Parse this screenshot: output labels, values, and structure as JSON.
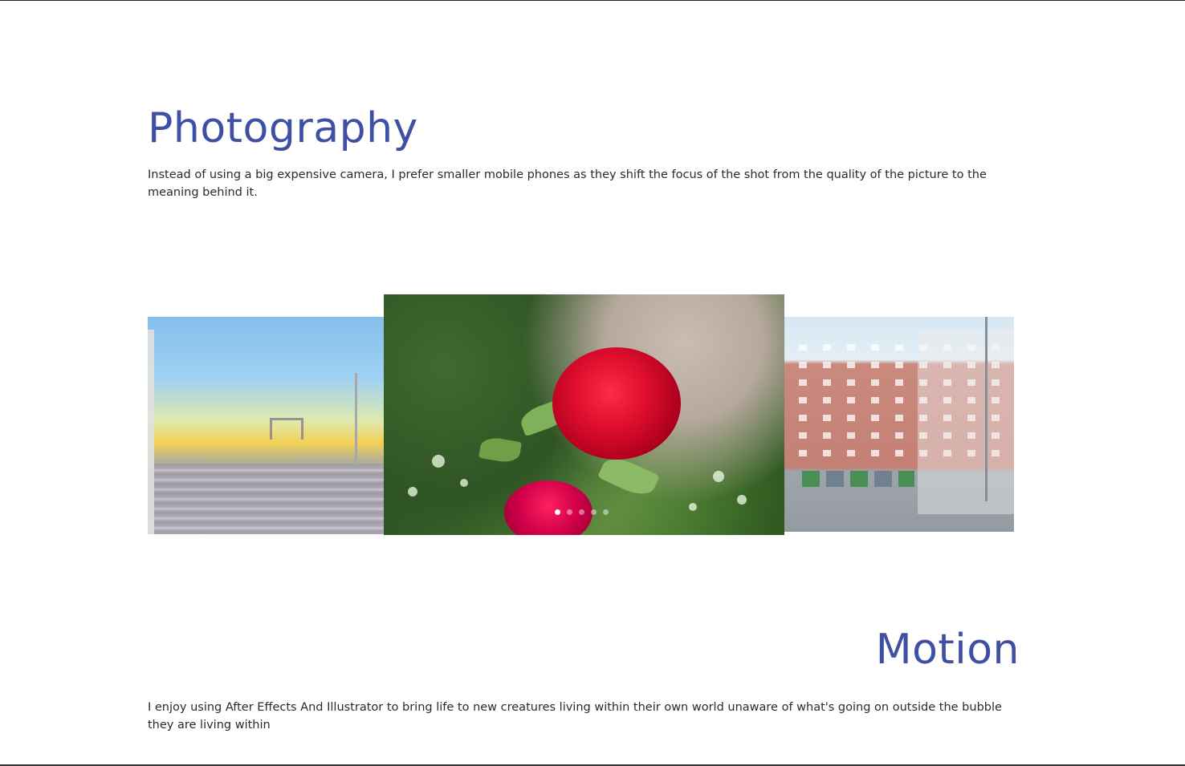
{
  "theme": {
    "accent": "#3f4fa3",
    "text": "#2a2a2a"
  },
  "photography": {
    "title": "Photography",
    "description": "Instead of using a big expensive camera, I prefer smaller mobile phones as they shift the focus of the shot from the quality of the picture to the meaning behind it."
  },
  "carousel": {
    "slide_count": 5,
    "active_index": 0,
    "slides": [
      "sunset-highway-photo",
      "red-rose-photo",
      "brick-apartment-building-photo"
    ]
  },
  "motion": {
    "title": "Motion",
    "description": "I enjoy using After Effects And Illustrator to bring life to new creatures living within their own world unaware of what's going on outside the bubble they are living within"
  }
}
